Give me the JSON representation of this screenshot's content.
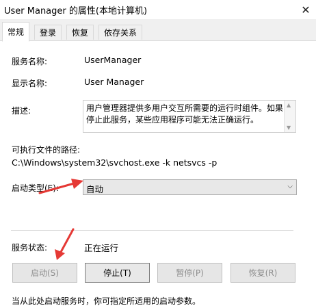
{
  "window": {
    "title": "User Manager 的属性(本地计算机)"
  },
  "tabs": [
    {
      "label": "常规",
      "active": true
    },
    {
      "label": "登录",
      "active": false
    },
    {
      "label": "恢复",
      "active": false
    },
    {
      "label": "依存关系",
      "active": false
    }
  ],
  "general": {
    "service_name_label": "服务名称:",
    "service_name": "UserManager",
    "display_name_label": "显示名称:",
    "display_name": "User Manager",
    "description_label": "描述:",
    "description": "用户管理器提供多用户交互所需要的运行时组件。如果停止此服务，某些应用程序可能无法正确运行。",
    "path_label": "可执行文件的路径:",
    "path": "C:\\Windows\\system32\\svchost.exe -k netsvcs -p",
    "startup_type_label": "启动类型(E):",
    "startup_type": "自动",
    "status_label": "服务状态:",
    "status": "正在运行",
    "buttons": {
      "start": "启动(S)",
      "stop": "停止(T)",
      "pause": "暂停(P)",
      "resume": "恢复(R)"
    },
    "hint": "当从此处启动服务时，你可指定所适用的启动参数。"
  },
  "colors": {
    "annotation_arrow": "#e53935",
    "active_tab": "#ffffff",
    "window_bg": "#f0f0f0"
  },
  "icons": {
    "close": "close-icon",
    "dropdown": "chevron-down-icon"
  }
}
